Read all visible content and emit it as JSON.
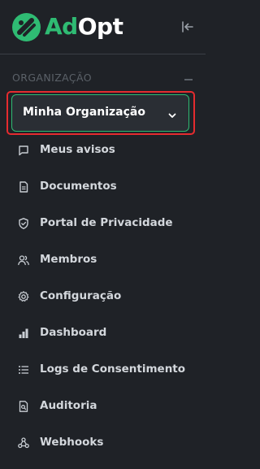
{
  "brand": {
    "prefix": "Ad",
    "suffix": "Opt",
    "accent_color": "#2fbb73"
  },
  "header": {
    "collapse_icon": "collapse-left-icon"
  },
  "section": {
    "label": "ORGANIZAÇÃO"
  },
  "org_select": {
    "value": "Minha Organização",
    "highlight_color": "#e52b2f"
  },
  "nav": {
    "items": [
      {
        "label": "Meus avisos",
        "icon": "message-icon"
      },
      {
        "label": "Documentos",
        "icon": "document-icon"
      },
      {
        "label": "Portal de Privacidade",
        "icon": "shield-icon"
      },
      {
        "label": "Membros",
        "icon": "users-icon"
      },
      {
        "label": "Configuração",
        "icon": "gear-icon"
      },
      {
        "label": "Dashboard",
        "icon": "bar-chart-icon"
      },
      {
        "label": "Logs de Consentimento",
        "icon": "list-icon"
      },
      {
        "label": "Auditoria",
        "icon": "audit-icon"
      },
      {
        "label": "Webhooks",
        "icon": "webhook-icon"
      }
    ]
  }
}
